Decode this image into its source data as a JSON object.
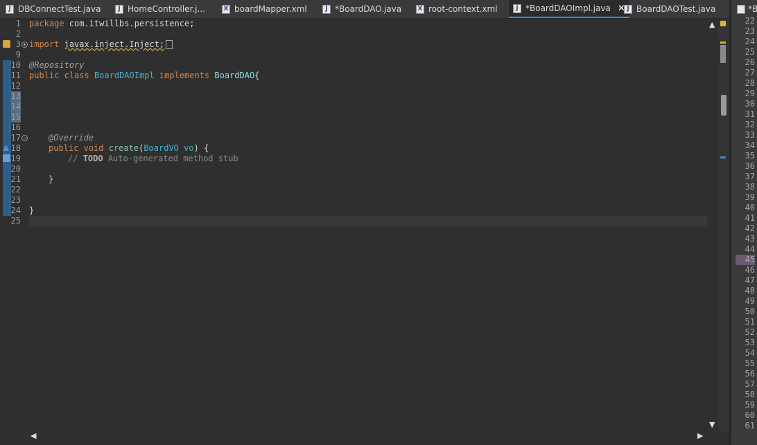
{
  "tabs": [
    {
      "label": "DBConnectTest.java",
      "icon": "java-file-icon"
    },
    {
      "label": "HomeController.j...",
      "icon": "java-file-icon"
    },
    {
      "label": "boardMapper.xml",
      "icon": "xml-file-icon"
    },
    {
      "label": "*BoardDAO.java",
      "icon": "java-file-icon"
    },
    {
      "label": "root-context.xml",
      "icon": "xml-file-icon"
    },
    {
      "label": "*BoardDAOImpl.java",
      "icon": "java-file-icon",
      "active": true
    },
    {
      "label": "BoardDAOTest.java",
      "icon": "java-file-icon"
    }
  ],
  "editor": {
    "line_numbers": [
      "1",
      "2",
      "3",
      "9",
      "10",
      "11",
      "12",
      "13",
      "14",
      "15",
      "16",
      "17",
      "18",
      "19",
      "20",
      "21",
      "22",
      "23",
      "24",
      "25"
    ],
    "line1": {
      "kw": "package",
      "text": " com.itwillbs.persistence;"
    },
    "line3": {
      "kw": "import",
      "squiggle": "javax.inject.Inject;"
    },
    "line10": "@Repository",
    "line11": {
      "kw1": "public",
      "kw2": "class",
      "cls": "BoardDAOImpl",
      "kw3": "implements",
      "iface": "BoardDAO",
      "brace": "{"
    },
    "line17": "@Override",
    "line18": {
      "kw1": "public",
      "kw2": "void",
      "method": "create",
      "open": "(",
      "type": "BoardVO",
      "param": "vo",
      "close": ") {"
    },
    "line19": {
      "prefix": "// ",
      "todo": "TODO",
      "rest": " Auto-generated method stub"
    },
    "line21": "}",
    "line24": "}"
  },
  "right_panel": {
    "tab_label": "*B",
    "line_numbers": [
      "22",
      "23",
      "24",
      "25",
      "26",
      "27",
      "28",
      "29",
      "30",
      "31",
      "32",
      "33",
      "34",
      "35",
      "36",
      "37",
      "38",
      "39",
      "40",
      "41",
      "42",
      "43",
      "44",
      "45",
      "46",
      "47",
      "48",
      "49",
      "50",
      "51",
      "52",
      "53",
      "54",
      "55",
      "56",
      "57",
      "58",
      "59",
      "60",
      "61"
    ],
    "highlighted": "45"
  },
  "colors": {
    "accent": "#4a88c7",
    "background": "#2f2f2f",
    "keyword": "#d2884f",
    "type": "#3fb6d6"
  }
}
